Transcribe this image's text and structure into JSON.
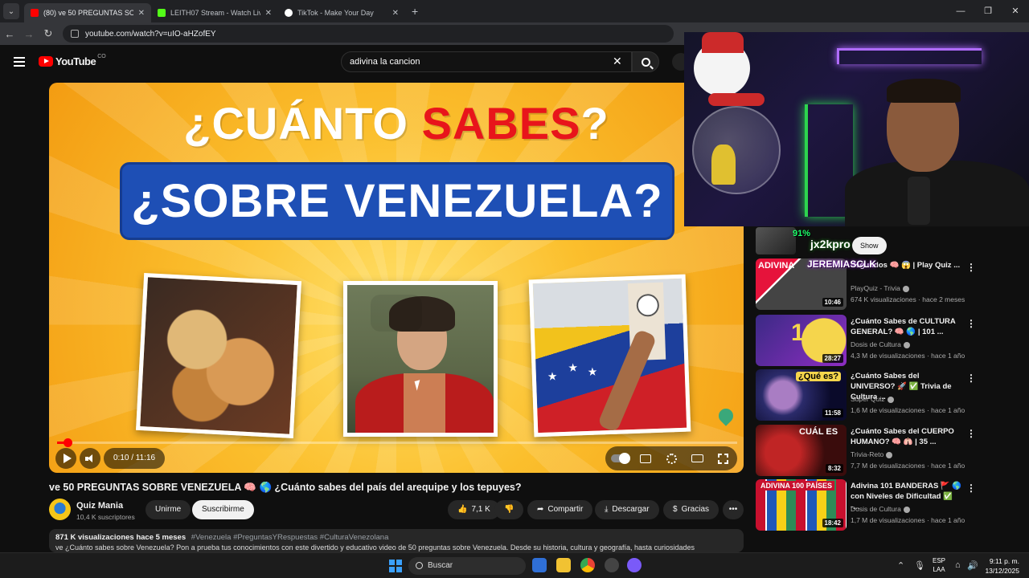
{
  "browser": {
    "tabs": [
      {
        "title": "(80) ve 50 PREGUNTAS SOBRE V",
        "active": true,
        "favicon_color": "#ff0000"
      },
      {
        "title": "LEITH07 Stream - Watch Live o",
        "active": false,
        "favicon_color": "#53fc18"
      },
      {
        "title": "TikTok - Make Your Day",
        "active": false,
        "favicon_color": "#ffffff"
      }
    ],
    "url": "youtube.com/watch?v=uIO-aHZofEY"
  },
  "header": {
    "logo_text": "YouTube",
    "country_code": "CO",
    "search_value": "adivina la cancion"
  },
  "player": {
    "overlay_line1_a": "¿CUÁNTO ",
    "overlay_line1_b": "SABES",
    "overlay_line1_c": "?",
    "overlay_line2": "¿SOBRE VENEZUELA?",
    "time": "0:10 / 11:16",
    "progress_fraction": 0.015
  },
  "video": {
    "title": "ve 50 PREGUNTAS SOBRE VENEZUELA 🧠 🌎 ¿Cuánto sabes del país del arequipe y los tepuyes?",
    "channel": "Quiz Mania",
    "subscribers": "10,4 K suscriptores",
    "join_label": "Unirme",
    "subscribe_label": "Suscribirme",
    "likes": "7,1 K",
    "share_label": "Compartir",
    "download_label": "Descargar",
    "thanks_label": "Gracias",
    "stats": "871 K visualizaciones  hace 5 meses",
    "tags": "#Venezuela #PreguntasYRespuestas #CulturaVenezolana",
    "description": "ve ¿Cuánto sabes sobre Venezuela? Pon a prueba tus conocimientos con este divertido y educativo video de 50 preguntas sobre Venezuela. Desde su historia, cultura y geografía, hasta curiosidades"
  },
  "overlay": {
    "percent": "91%",
    "user": "jx2kpro",
    "show_label": "Show",
    "subscriber": "JEREMIASCLK"
  },
  "recommendations": [
    {
      "title": "Segundos 🧠 😱 | Play Quiz ...",
      "channel": "PlayQuiz - Trivia",
      "meta": "674 K visualizaciones · hace 2 meses",
      "duration": "10:46",
      "thumb_text": "ADIVINA"
    },
    {
      "title": "¿Cuánto Sabes de CULTURA GENERAL? 🧠 🌎 | 101 ...",
      "channel": "Dosis de Cultura",
      "meta": "4,3 M de visualizaciones · hace 1 año",
      "duration": "28:27",
      "thumb_text": "100"
    },
    {
      "title": "¿Cuánto Sabes del UNIVERSO? 🚀 ✅ Trivia de Cultura ...",
      "channel": "Super Quiz",
      "meta": "1,6 M de visualizaciones · hace 1 año",
      "duration": "11:58",
      "thumb_text": "¿Qué es?"
    },
    {
      "title": "¿Cuánto Sabes del CUERPO HUMANO? 🧠 🫁 | 35 ...",
      "channel": "Trivia-Reto",
      "meta": "7,7 M de visualizaciones · hace 1 año",
      "duration": "8:32",
      "thumb_text": "CUÁL ES"
    },
    {
      "title": "Adivina 101 BANDERAS 🚩 🌎 con Niveles de Dificultad ✅ -...",
      "channel": "Dosis de Cultura",
      "meta": "1,7 M de visualizaciones · hace 1 año",
      "duration": "18:42",
      "thumb_text": "ADIVINA 100 PAÍSES"
    }
  ],
  "taskbar": {
    "search_label": "Buscar",
    "lang_top": "ESP",
    "lang_bottom": "LAA",
    "time": "9:11 p. m.",
    "date": "13/12/2025"
  }
}
